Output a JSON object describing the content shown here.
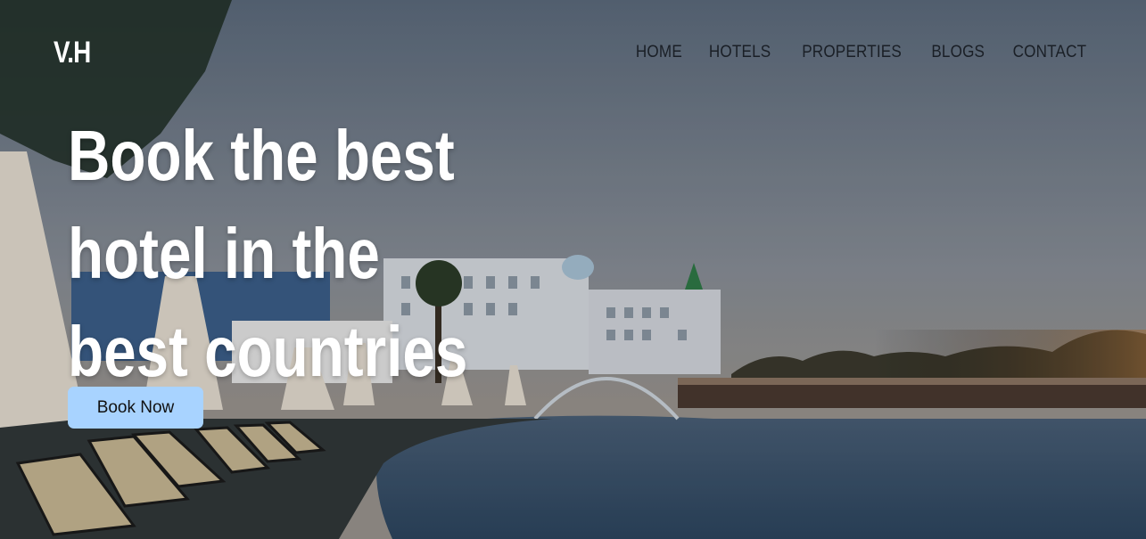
{
  "header": {
    "logo": "V.H",
    "nav": [
      {
        "label": "HOME"
      },
      {
        "label": "HOTELS"
      },
      {
        "label": "PROPERTIES"
      },
      {
        "label": "BLOGS"
      },
      {
        "label": "CONTACT"
      }
    ]
  },
  "hero": {
    "headline": "Book the best hotel in the best countries",
    "cta_label": "Book Now",
    "background_image": "resort-pool-hotel-photo"
  },
  "colors": {
    "cta_background": "#a8d3ff",
    "nav_text": "#1a1f26",
    "headline_text": "#ffffff"
  }
}
